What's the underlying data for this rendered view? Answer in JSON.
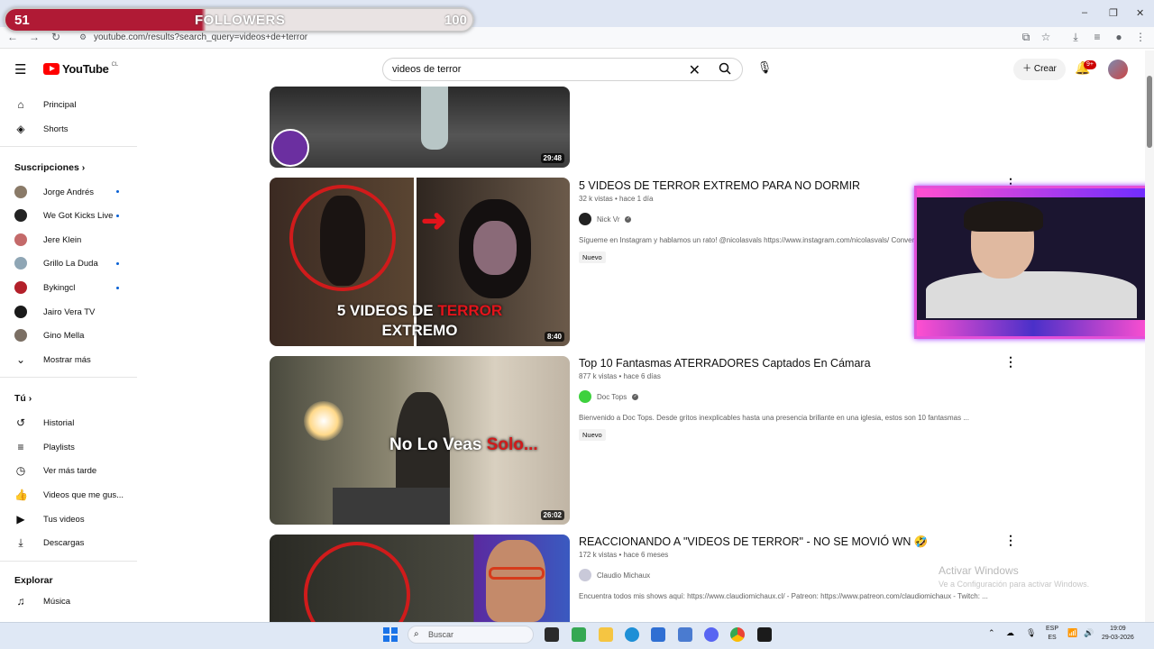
{
  "overlay": {
    "left_count": "51",
    "label": "FOLLOWERS",
    "right_count": "100"
  },
  "browser": {
    "url": "youtube.com/results?search_query=videos+de+terror"
  },
  "youtube": {
    "logo_text": "YouTube",
    "country": "CL",
    "search_value": "videos de terror",
    "create_label": "Crear",
    "notification_badge": "9+"
  },
  "sidebar": {
    "main": [
      {
        "label": "Principal",
        "icon": "home-icon"
      },
      {
        "label": "Shorts",
        "icon": "shorts-icon"
      }
    ],
    "subs_heading": "Suscripciones",
    "subs": [
      {
        "label": "Jorge Andrés",
        "color": "#8a7a68",
        "dot": true
      },
      {
        "label": "We Got Kicks Live",
        "color": "#222222",
        "dot": true
      },
      {
        "label": "Jere Klein",
        "color": "#c46a6a",
        "dot": false
      },
      {
        "label": "Grillo La Duda",
        "color": "#8fa6b5",
        "dot": true
      },
      {
        "label": "Bykingcl",
        "color": "#b3202a",
        "dot": true
      },
      {
        "label": "Jairo Vera TV",
        "color": "#1a1a1a",
        "dot": false
      },
      {
        "label": "Gino Mella",
        "color": "#7b6f64",
        "dot": false
      }
    ],
    "show_more": "Mostrar más",
    "you_heading": "Tú",
    "you": [
      {
        "label": "Historial",
        "icon": "history-icon"
      },
      {
        "label": "Playlists",
        "icon": "playlists-icon"
      },
      {
        "label": "Ver más tarde",
        "icon": "watch-later-icon"
      },
      {
        "label": "Videos que me gus...",
        "icon": "like-icon"
      },
      {
        "label": "Tus videos",
        "icon": "your-videos-icon"
      },
      {
        "label": "Descargas",
        "icon": "downloads-icon"
      }
    ],
    "explore_heading": "Explorar",
    "explore": [
      {
        "label": "Música",
        "icon": "music-icon"
      }
    ]
  },
  "results": [
    {
      "duration": "29:48"
    },
    {
      "title": "5 VIDEOS DE TERROR EXTREMO PARA NO DORMIR",
      "meta": "32 k vistas • hace 1 día",
      "channel": "Nick Vr",
      "desc": "Sígueme en Instagram y hablamos un rato! @nicolasvals https://www.instagram.com/nicolasvals/ Conver",
      "badge": "Nuevo",
      "duration": "8:40",
      "thumb_text_1": "5 VIDEOS DE",
      "thumb_text_red": "TERROR",
      "thumb_text_2": "EXTREMO"
    },
    {
      "title": "Top 10 Fantasmas ATERRADORES Captados En Cámara",
      "meta": "877 k vistas • hace 6 días",
      "channel": "Doc Tops",
      "desc": "Bienvenido a Doc Tops. Desde gritos inexplicables hasta una presencia brillante en una iglesia, estos son 10 fantasmas ...",
      "badge": "Nuevo",
      "duration": "26:02",
      "thumb_text_1": "No Lo Veas",
      "thumb_text_red": "Solo..."
    },
    {
      "title": "REACCIONANDO A \"VIDEOS DE TERROR\" - NO SE MOVIÓ WN 🤣",
      "meta": "172 k vistas • hace 6 meses",
      "channel": "Claudio Michaux",
      "desc": "Encuentra todos mis shows aquí: https://www.claudiomichaux.cl/ - Patreon: https://www.patreon.com/claudiomichaux - Twitch: ..."
    }
  ],
  "watermark": {
    "line1": "Activar Windows",
    "line2": "Ve a Configuración para activar Windows."
  },
  "taskbar": {
    "search": "Buscar",
    "lang1": "ESP",
    "lang2": "ES",
    "time": "19:09",
    "date": "29-03-2026"
  }
}
